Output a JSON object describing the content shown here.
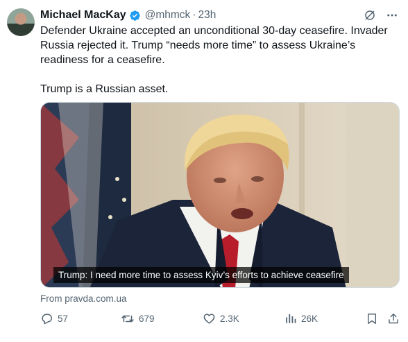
{
  "author": {
    "name": "Michael MacKay",
    "handle": "@mhmck",
    "time": "23h",
    "avatar_icon": "avatar-photo",
    "verified_color": "#1d9bf0"
  },
  "tweet": {
    "text": "Defender Ukraine accepted an unconditional 30-day ceasefire. Invader Russia rejected it. Trump “needs more time” to assess Ukraine’s readiness for a ceasefire.\n\nTrump is a Russian asset."
  },
  "media": {
    "caption": "Trump: I need more time to assess Kyiv’s efforts to achieve ceasefire",
    "source": "From pravda.com.ua"
  },
  "metrics": {
    "replies": "57",
    "reposts": "679",
    "likes": "2.3K",
    "views": "26K"
  },
  "colors": {
    "text": "#0f1419",
    "secondary": "#536471",
    "accent": "#1d9bf0"
  }
}
